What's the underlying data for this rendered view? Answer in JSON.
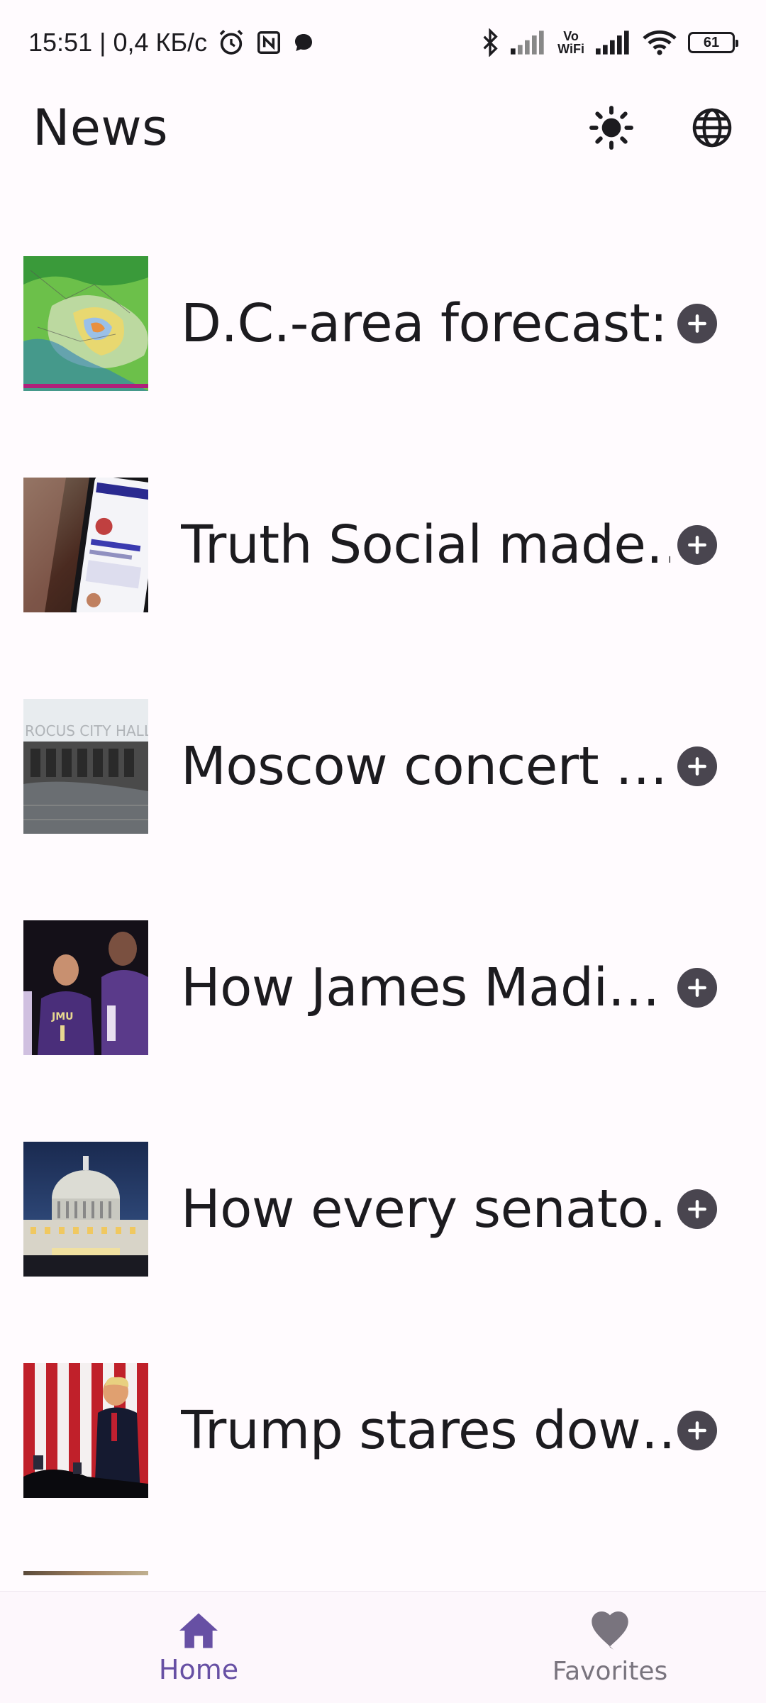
{
  "status_bar": {
    "time_speed": "15:51 | 0,4 КБ/с",
    "vowifi_top": "Vo",
    "vowifi_bottom": "WiFi",
    "battery": "61"
  },
  "app_bar": {
    "title": "News",
    "theme_icon": "sun-icon",
    "language_icon": "globe-icon"
  },
  "news": {
    "items": [
      {
        "title": "D.C.-area forecast:…",
        "thumb": "weather-map"
      },
      {
        "title": "Truth Social made…",
        "thumb": "phone-app"
      },
      {
        "title": "Moscow concert …",
        "thumb": "burned-building"
      },
      {
        "title": "How James Madi…",
        "thumb": "basketball-players"
      },
      {
        "title": "How every senato…",
        "thumb": "capitol-night"
      },
      {
        "title": "Trump stares dow…",
        "thumb": "rally-flag"
      }
    ],
    "add_icon": "plus-circle-icon"
  },
  "bottom_nav": {
    "home_label": "Home",
    "favorites_label": "Favorites",
    "accent": "#6750a4",
    "inactive": "#79747e"
  }
}
